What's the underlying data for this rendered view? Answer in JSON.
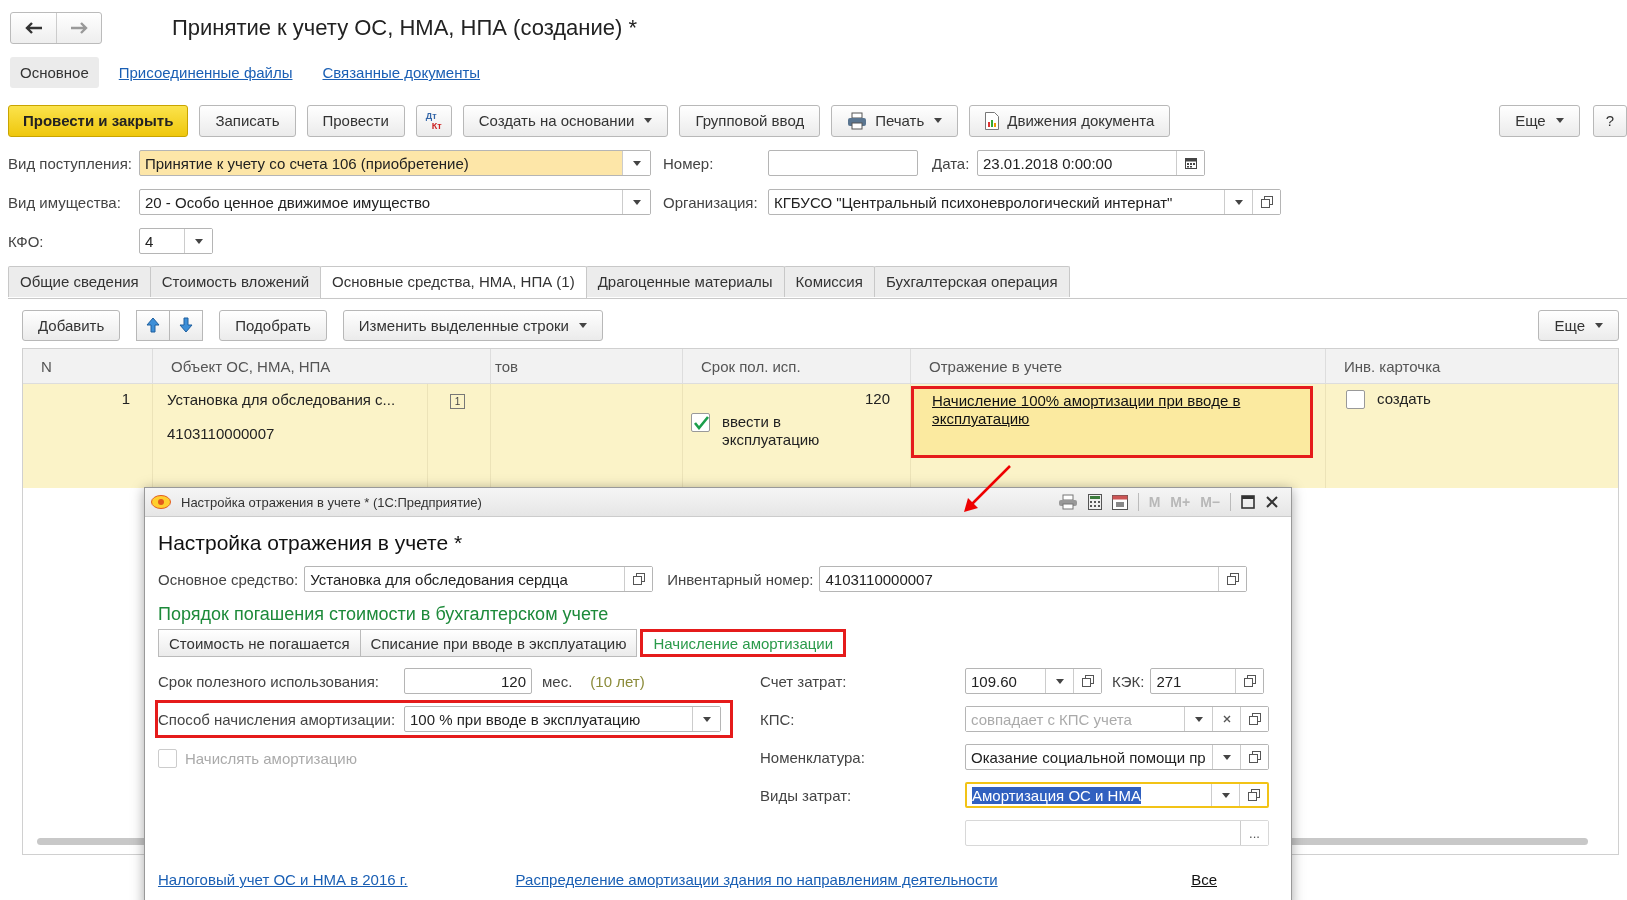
{
  "title": "Принятие к учету ОС, НМА, НПА (создание) *",
  "page_tabs": [
    {
      "label": "Основное",
      "selected": true
    },
    {
      "label": "Присоединенные файлы",
      "selected": false
    },
    {
      "label": "Связанные документы",
      "selected": false
    }
  ],
  "toolbar": [
    {
      "kind": "primary",
      "label": "Провести и закрыть"
    },
    {
      "kind": "plain",
      "label": "Записать"
    },
    {
      "kind": "plain",
      "label": "Провести"
    },
    {
      "kind": "dtkt",
      "top": "Дт",
      "bottom": "Кт"
    },
    {
      "kind": "menu",
      "label": "Создать на основании"
    },
    {
      "kind": "plain",
      "label": "Групповой ввод"
    },
    {
      "kind": "print",
      "label": "Печать"
    },
    {
      "kind": "report",
      "label": "Движения документа"
    }
  ],
  "toolbar_right": [
    {
      "kind": "menu",
      "label": "Еще"
    },
    {
      "kind": "plain",
      "label": "?"
    }
  ],
  "receipt_type": {
    "label": "Вид поступления:",
    "value": "Принятие к учету со счета 106 (приобретение)",
    "highlighted": true
  },
  "number": {
    "label": "Номер:"
  },
  "date": {
    "label": "Дата:",
    "value": "23.01.2018  0:00:00"
  },
  "property_type": {
    "label": "Вид имущества:",
    "value": "20 - Особо ценное движимое имущество"
  },
  "organization": {
    "label": "Организация:",
    "value": "КГБУСО \"Центральный психоневрологический интернат\""
  },
  "kfo": {
    "label": "КФО:",
    "value": "4"
  },
  "doc_tabs": [
    {
      "label": "Общие сведения",
      "selected": false
    },
    {
      "label": "Стоимость вложений",
      "selected": false
    },
    {
      "label": "Основные средства, НМА, НПА (1)",
      "selected": true
    },
    {
      "label": "Драгоценные материалы",
      "selected": false
    },
    {
      "label": "Комиссия",
      "selected": false
    },
    {
      "label": "Бухгалтерская операция",
      "selected": false
    }
  ],
  "table_toolbar": {
    "add": "Добавить",
    "pick": "Подобрать",
    "change": "Изменить выделенные строки",
    "more": "Еще"
  },
  "table": {
    "columns": [
      "N",
      "Объект ОС, НМА, НПА",
      "тов",
      "Срок пол. исп.",
      "Отражение в учете",
      "Инв. карточка"
    ],
    "rows": [
      {
        "selected": true,
        "n": "1",
        "object": "Установка для обследования с...",
        "object_badge": "1",
        "object_code": "4103110000007",
        "term": "120",
        "commission": {
          "label": "ввести в эксплуатацию",
          "checked": true
        },
        "accounting": {
          "text": "Начисление 100% амортизации при вводе в эксплуатацию",
          "annotated": true
        },
        "card": {
          "label": "создать",
          "checked": false
        }
      }
    ]
  },
  "dialog": {
    "window_title": "Настройка отражения в учете * (1С:Предприятие)",
    "memory_buttons": [
      "M",
      "M+",
      "M−"
    ],
    "header": "Настройка отражения в учете *",
    "asset": {
      "label": "Основное средство:",
      "value": "Установка для обследования сердца"
    },
    "inventory": {
      "label": "Инвентарный номер:",
      "value": "4103110000007"
    },
    "section": "Порядок погашения стоимости в бухгалтерском учете",
    "modes": [
      {
        "label": "Стоимость не погашается",
        "selected": false,
        "annotated": false
      },
      {
        "label": "Списание при вводе в эксплуатацию",
        "selected": false,
        "annotated": false
      },
      {
        "label": "Начисление амортизации",
        "selected": true,
        "annotated": true
      }
    ],
    "useful_life": {
      "label": "Срок полезного использования:",
      "value": "120",
      "unit": "мес.",
      "note": "(10 лет)"
    },
    "method": {
      "label": "Способ начисления амортизации:",
      "value": "100 % при вводе в эксплуатацию",
      "annotated": true
    },
    "accrue": {
      "label": "Начислять амортизацию",
      "checked": false,
      "disabled": true
    },
    "cost_account": {
      "label": "Счет затрат:",
      "value": "109.60"
    },
    "kek": {
      "label": "КЭК:",
      "value": "271"
    },
    "kps": {
      "label": "КПС:",
      "placeholder": "совпадает с КПС учета"
    },
    "nomenclature": {
      "label": "Номенклатура:",
      "value": "Оказание социальной помощи пр"
    },
    "cost_types": {
      "label": "Виды затрат:",
      "value": "Амортизация ОС и НМА",
      "focused": true
    },
    "extra_button": "...",
    "links": [
      "Налоговый учет ОС и НМА в 2016 г.",
      "Распределение амортизации здания по направлениям деятельности"
    ],
    "all_link": "Все"
  }
}
